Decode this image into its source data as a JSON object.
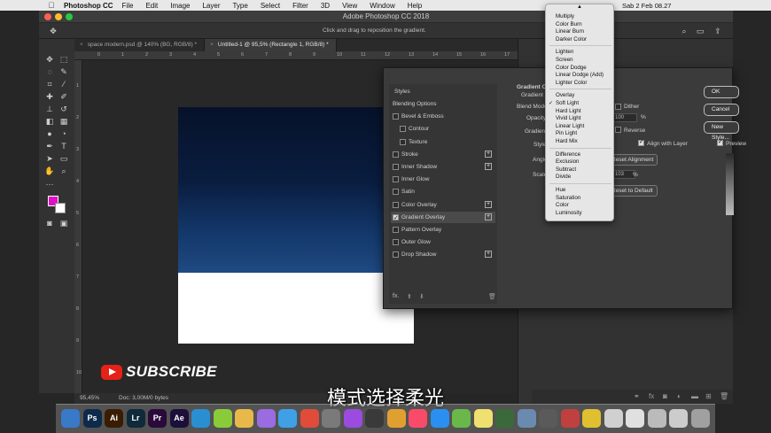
{
  "menubar": {
    "app_name": "Photoshop CC",
    "menus": [
      "File",
      "Edit",
      "Image",
      "Layer",
      "Type",
      "Select",
      "Filter",
      "3D",
      "View",
      "Window",
      "Help"
    ],
    "clock": "Sab 2 Feb  08.27"
  },
  "window": {
    "title": "Adobe Photoshop CC 2018",
    "hint": "Click and drag to reposition the gradient."
  },
  "tabs": [
    {
      "label": "space modern.psd @ 140% (BG, RGB/8) *",
      "active": false
    },
    {
      "label": "Untitled-1 @ 95,5% (Rectangle 1, RGB/8) *",
      "active": true
    }
  ],
  "ruler": {
    "h_ticks": [
      "0",
      "1",
      "2",
      "3",
      "4",
      "5",
      "6",
      "7",
      "8",
      "9",
      "10",
      "11",
      "12",
      "13",
      "14",
      "15",
      "16",
      "17",
      "18"
    ],
    "v_ticks": [
      "1",
      "2",
      "3",
      "4",
      "5",
      "6",
      "7",
      "8",
      "9",
      "10"
    ]
  },
  "status": {
    "zoom": "95,45%",
    "doc": "Doc: 3,00M/0 bytes"
  },
  "colors": {
    "foreground": "#e010c8",
    "background": "#ffffff",
    "gradient_top": "#06122a",
    "gradient_bottom": "#1f4a82"
  },
  "layer_style": {
    "header": "Styles",
    "items": [
      {
        "label": "Blending Options",
        "checkbox": false,
        "checked": false,
        "plus": false,
        "indent": false
      },
      {
        "label": "Bevel & Emboss",
        "checkbox": true,
        "checked": false,
        "plus": false,
        "indent": false
      },
      {
        "label": "Contour",
        "checkbox": true,
        "checked": false,
        "plus": false,
        "indent": true
      },
      {
        "label": "Texture",
        "checkbox": true,
        "checked": false,
        "plus": false,
        "indent": true
      },
      {
        "label": "Stroke",
        "checkbox": true,
        "checked": false,
        "plus": true,
        "indent": false
      },
      {
        "label": "Inner Shadow",
        "checkbox": true,
        "checked": false,
        "plus": true,
        "indent": false
      },
      {
        "label": "Inner Glow",
        "checkbox": true,
        "checked": false,
        "plus": false,
        "indent": false
      },
      {
        "label": "Satin",
        "checkbox": true,
        "checked": false,
        "plus": false,
        "indent": false
      },
      {
        "label": "Color Overlay",
        "checkbox": true,
        "checked": false,
        "plus": true,
        "indent": false
      },
      {
        "label": "Gradient Overlay",
        "checkbox": true,
        "checked": true,
        "plus": true,
        "indent": false,
        "selected": true
      },
      {
        "label": "Pattern Overlay",
        "checkbox": true,
        "checked": false,
        "plus": false,
        "indent": false
      },
      {
        "label": "Outer Glow",
        "checkbox": true,
        "checked": false,
        "plus": false,
        "indent": false
      },
      {
        "label": "Drop Shadow",
        "checkbox": true,
        "checked": false,
        "plus": true,
        "indent": false
      }
    ],
    "fx": "fx.",
    "section_title": "Gradient Ov",
    "section_sub": "Gradient",
    "labels": {
      "blend_mode": "Blend Mode",
      "opacity": "Opacity",
      "gradient": "Gradient",
      "style": "Style",
      "angle": "Angle",
      "scale": "Scale"
    },
    "opacity_value": "100",
    "scale_value": "103",
    "percent": "%",
    "dither": "Dither",
    "reverse": "Reverse",
    "align_with_layer": "Align with Layer",
    "reset_alignment": "Reset Alignment",
    "reset_to_default": "Reset to Default",
    "ok": "OK",
    "cancel": "Cancel",
    "new_style": "New Style...",
    "preview": "Preview"
  },
  "blend_modes": {
    "groups": [
      [
        "Multiply",
        "Color Burn",
        "Linear Burn",
        "Darker Color"
      ],
      [
        "Lighten",
        "Screen",
        "Color Dodge",
        "Linear Dodge (Add)",
        "Lighter Color"
      ],
      [
        "Overlay",
        "Soft Light",
        "Hard Light",
        "Vivid Light",
        "Linear Light",
        "Pin Light",
        "Hard Mix"
      ],
      [
        "Difference",
        "Exclusion",
        "Subtract",
        "Divide"
      ],
      [
        "Hue",
        "Saturation",
        "Color",
        "Luminosity"
      ]
    ],
    "selected": "Soft Light"
  },
  "overlay": {
    "subscribe": "SUBSCRIBE",
    "subtitle": "模式选择柔光"
  },
  "dock": {
    "apps": [
      {
        "label": "",
        "color": "#3a78c8"
      },
      {
        "label": "Ps",
        "color": "#0d2a4a"
      },
      {
        "label": "Ai",
        "color": "#3a1c00"
      },
      {
        "label": "Lr",
        "color": "#0f2a3a"
      },
      {
        "label": "Pr",
        "color": "#2a0a3a"
      },
      {
        "label": "Ae",
        "color": "#1c0f3a"
      },
      {
        "label": "",
        "color": "#2a8fd0"
      },
      {
        "label": "",
        "color": "#8acb3a"
      },
      {
        "label": "",
        "color": "#e8b84a"
      },
      {
        "label": "",
        "color": "#9b6be0"
      },
      {
        "label": "",
        "color": "#3fa0e6"
      },
      {
        "label": "",
        "color": "#e04b3a"
      },
      {
        "label": "",
        "color": "#7a7a7a"
      },
      {
        "label": "",
        "color": "#9c4be0"
      },
      {
        "label": "",
        "color": "#3a3a3a"
      },
      {
        "label": "",
        "color": "#e0a030"
      },
      {
        "label": "",
        "color": "#fa4a6a"
      },
      {
        "label": "",
        "color": "#2a8ff0"
      },
      {
        "label": "",
        "color": "#6ab84a"
      },
      {
        "label": "",
        "color": "#f0e070"
      },
      {
        "label": "",
        "color": "#3a6a3a"
      },
      {
        "label": "",
        "color": "#6a8ab0"
      },
      {
        "label": "",
        "color": "#5a5a5a"
      },
      {
        "label": "",
        "color": "#c04040"
      },
      {
        "label": "",
        "color": "#e0c030"
      },
      {
        "label": "",
        "color": "#d0d0d0"
      },
      {
        "label": "",
        "color": "#e0e0e0"
      },
      {
        "label": "",
        "color": "#bbbbbb"
      },
      {
        "label": "",
        "color": "#cccccc"
      },
      {
        "label": "",
        "color": "#a0a0a0"
      }
    ]
  }
}
